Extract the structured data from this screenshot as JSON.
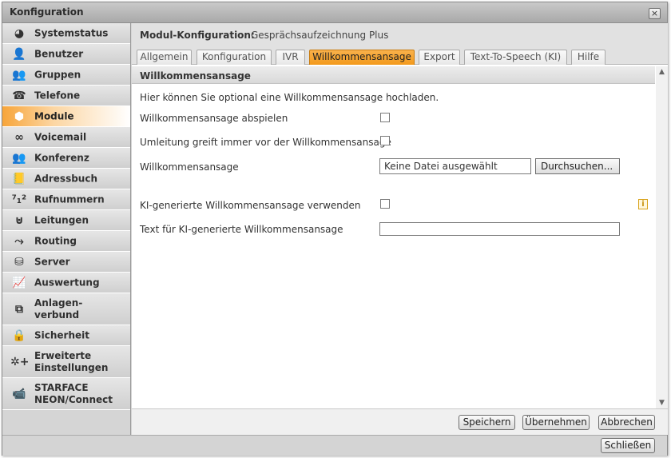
{
  "window": {
    "title": "Konfiguration",
    "close_glyph": "×"
  },
  "sidebar": {
    "items": [
      {
        "label": "Systemstatus",
        "icon": "status-icon",
        "glyph": "◕"
      },
      {
        "label": "Benutzer",
        "icon": "user-icon",
        "glyph": "👤"
      },
      {
        "label": "Gruppen",
        "icon": "group-icon",
        "glyph": "👥"
      },
      {
        "label": "Telefone",
        "icon": "phone-icon",
        "glyph": "☎"
      },
      {
        "label": "Module",
        "icon": "module-icon",
        "glyph": "⬢"
      },
      {
        "label": "Voicemail",
        "icon": "voicemail-icon",
        "glyph": "∞"
      },
      {
        "label": "Konferenz",
        "icon": "conference-icon",
        "glyph": "👥"
      },
      {
        "label": "Adressbuch",
        "icon": "addressbook-icon",
        "glyph": "📒"
      },
      {
        "label": "Rufnummern",
        "icon": "numbers-icon",
        "glyph": "⁷₁²"
      },
      {
        "label": "Leitungen",
        "icon": "lines-icon",
        "glyph": "⊍"
      },
      {
        "label": "Routing",
        "icon": "routing-icon",
        "glyph": "⤳"
      },
      {
        "label": "Server",
        "icon": "server-icon",
        "glyph": "⛁"
      },
      {
        "label": "Auswertung",
        "icon": "chart-icon",
        "glyph": "📈"
      },
      {
        "label_line1": "Anlagen-",
        "label_line2": "verbund",
        "icon": "network-icon",
        "glyph": "⧉"
      },
      {
        "label": "Sicherheit",
        "icon": "lock-icon",
        "glyph": "🔒"
      },
      {
        "label_line1": "Erweiterte",
        "label_line2": "Einstellungen",
        "icon": "advanced-settings-icon",
        "glyph": "✲+"
      },
      {
        "label_line1": "STARFACE",
        "label_line2": "NEON/Connect",
        "icon": "camera-icon",
        "glyph": "📹"
      }
    ],
    "active_index": 4
  },
  "header": {
    "label": "Modul-Konfiguration:",
    "value": "Gesprächsaufzeichnung Plus"
  },
  "tabs": [
    {
      "label": "Allgemein"
    },
    {
      "label": "Konfiguration"
    },
    {
      "label": "IVR"
    },
    {
      "label": "Willkommensansage",
      "active": true
    },
    {
      "label": "Export"
    },
    {
      "label": "Text-To-Speech (KI)"
    },
    {
      "label": "Hilfe"
    }
  ],
  "section": {
    "title": "Willkommensansage",
    "intro": "Hier können Sie optional eine Willkommensansage hochladen.",
    "fields": {
      "play_label": "Willkommensansage abspielen",
      "redirect_label": "Umleitung greift immer vor der Willkommensansage",
      "file_label": "Willkommensansage",
      "file_value": "Keine Datei ausgewählt",
      "browse_label": "Durchsuchen...",
      "ai_label": "KI-generierte Willkommensansage verwenden",
      "ai_text_label": "Text für KI-generierte Willkommensansage",
      "ai_text_value": "",
      "info_glyph": "i"
    }
  },
  "footer": {
    "save": "Speichern",
    "apply": "Übernehmen",
    "cancel": "Abbrechen"
  },
  "bottombar": {
    "close": "Schließen"
  },
  "scroll": {
    "up_glyph": "▲",
    "down_glyph": "▼"
  }
}
